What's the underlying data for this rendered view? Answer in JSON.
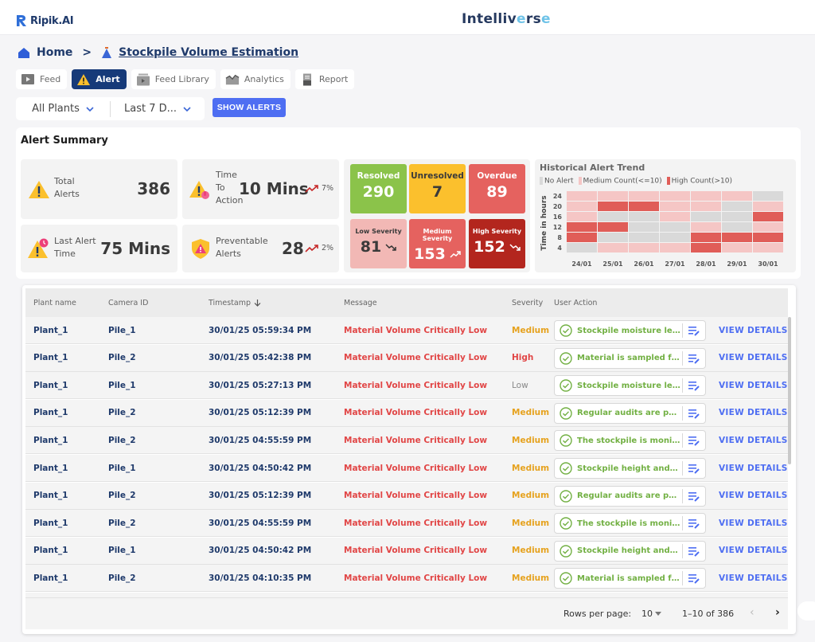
{
  "header": {
    "logo_text": "Ripik.AI",
    "brand_left": "Intelliv",
    "brand_accent": "e",
    "brand_mid": "rs",
    "brand_end": "e"
  },
  "breadcrumb": {
    "home": "Home",
    "separator": ">",
    "current": "Stockpile Volume Estimation"
  },
  "tabs": [
    {
      "label": "Feed",
      "icon": "play-screen-icon",
      "active": false
    },
    {
      "label": "Alert",
      "icon": "warning-icon",
      "active": true
    },
    {
      "label": "Feed Library",
      "icon": "video-library-icon",
      "active": false
    },
    {
      "label": "Analytics",
      "icon": "area-chart-icon",
      "active": false
    },
    {
      "label": "Report",
      "icon": "document-icon",
      "active": false
    }
  ],
  "filters": {
    "plant": "All Plants",
    "range": "Last 7 D...",
    "show_button": "SHOW ALERTS"
  },
  "summary": {
    "title": "Alert Summary",
    "kpis": {
      "total": {
        "label_1": "Total",
        "label_2": "Alerts",
        "value": "386"
      },
      "tta": {
        "label_1": "Time",
        "label_2": "To",
        "label_3": "Action",
        "value": "10 Mins",
        "trend": "7%",
        "trend_dir": "up"
      },
      "last": {
        "label_1": "Last Alert",
        "label_2": "Time",
        "value": "75 Mins"
      },
      "preventable": {
        "label_1": "Preventable",
        "label_2": "Alerts",
        "value": "28",
        "trend": "2%",
        "trend_dir": "up"
      }
    },
    "status": {
      "resolved": {
        "label": "Resolved",
        "value": "290",
        "color": "#8bc34a"
      },
      "unresolved": {
        "label": "Unresolved",
        "value": "7",
        "color": "#fbc02d"
      },
      "overdue": {
        "label": "Overdue",
        "value": "89",
        "color": "#e5625f"
      },
      "low": {
        "label": "Low Severity",
        "value": "81",
        "trend_dir": "down",
        "color": "#f2b8b5"
      },
      "medium": {
        "label": "Medium Severity",
        "value": "153",
        "trend_dir": "up",
        "color": "#e5625f"
      },
      "high": {
        "label": "High Severity",
        "value": "152",
        "trend_dir": "down",
        "color": "#b3261e"
      }
    }
  },
  "chart_data": {
    "type": "heatmap",
    "title": "Historical Alert Trend",
    "legend": [
      {
        "label": "No Alert",
        "color": "#d9d9d9",
        "key": "N"
      },
      {
        "label": "Medium Count(<=10)",
        "color": "#f5c6c5",
        "key": "M"
      },
      {
        "label": "High Count(>10)",
        "color": "#e05d58",
        "key": "H"
      }
    ],
    "ylabel": "Time in hours",
    "x": [
      "24/01",
      "25/01",
      "26/01",
      "27/01",
      "28/01",
      "29/01",
      "30/01"
    ],
    "y": [
      "24",
      "20",
      "16",
      "12",
      "8",
      "4"
    ],
    "cells": [
      [
        "M",
        "M",
        "M",
        "M",
        "M",
        "M",
        "N"
      ],
      [
        "M",
        "H",
        "H",
        "M",
        "M",
        "N",
        "M"
      ],
      [
        "M",
        "N",
        "N",
        "M",
        "N",
        "N",
        "H"
      ],
      [
        "H",
        "H",
        "N",
        "N",
        "M",
        "N",
        "M"
      ],
      [
        "H",
        "N",
        "N",
        "N",
        "H",
        "H",
        "H"
      ],
      [
        "N",
        "M",
        "M",
        "M",
        "H",
        "M",
        "M"
      ]
    ]
  },
  "table": {
    "headers": {
      "plant": "Plant name",
      "camera": "Camera ID",
      "timestamp": "Timestamp",
      "message": "Message",
      "severity": "Severity",
      "action": "User Action"
    },
    "view_label": "VIEW DETAILS",
    "rows": [
      {
        "plant": "Plant_1",
        "camera": "Pile_1",
        "timestamp": "30/01/25 05:59:34 PM",
        "message": "Material Volume Critically Low",
        "severity": "Medium",
        "action": "Stockpile moisture lev..."
      },
      {
        "plant": "Plant_1",
        "camera": "Pile_2",
        "timestamp": "30/01/25 05:42:38 PM",
        "message": "Material Volume Critically Low",
        "severity": "High",
        "action": "Material is sampled fro..."
      },
      {
        "plant": "Plant_1",
        "camera": "Pile_1",
        "timestamp": "30/01/25 05:27:13 PM",
        "message": "Material Volume Critically Low",
        "severity": "Low",
        "action": "Stockpile moisture lev..."
      },
      {
        "plant": "Plant_1",
        "camera": "Pile_2",
        "timestamp": "30/01/25 05:12:39 PM",
        "message": "Material Volume Critically Low",
        "severity": "Medium",
        "action": "Regular audits are per..."
      },
      {
        "plant": "Plant_1",
        "camera": "Pile_2",
        "timestamp": "30/01/25 04:55:59 PM",
        "message": "Material Volume Critically Low",
        "severity": "Medium",
        "action": "The stockpile is monito..."
      },
      {
        "plant": "Plant_1",
        "camera": "Pile_1",
        "timestamp": "30/01/25 04:50:42 PM",
        "message": "Material Volume Critically Low",
        "severity": "Medium",
        "action": "Stockpile height and v..."
      },
      {
        "plant": "Plant_1",
        "camera": "Pile_2",
        "timestamp": "30/01/25 05:12:39 PM",
        "message": "Material Volume Critically Low",
        "severity": "Medium",
        "action": "Regular audits are per..."
      },
      {
        "plant": "Plant_1",
        "camera": "Pile_2",
        "timestamp": "30/01/25 04:55:59 PM",
        "message": "Material Volume Critically Low",
        "severity": "Medium",
        "action": "The stockpile is monito..."
      },
      {
        "plant": "Plant_1",
        "camera": "Pile_1",
        "timestamp": "30/01/25 04:50:42 PM",
        "message": "Material Volume Critically Low",
        "severity": "Medium",
        "action": "Stockpile height and v..."
      },
      {
        "plant": "Plant_1",
        "camera": "Pile_2",
        "timestamp": "30/01/25 04:10:35 PM",
        "message": "Material Volume Critically Low",
        "severity": "Medium",
        "action": "Material is sampled fro..."
      }
    ],
    "pagination": {
      "rows_per_page_label": "Rows per page:",
      "rows_per_page": "10",
      "range": "1–10 of 386",
      "prev": "‹",
      "next": "›"
    }
  }
}
